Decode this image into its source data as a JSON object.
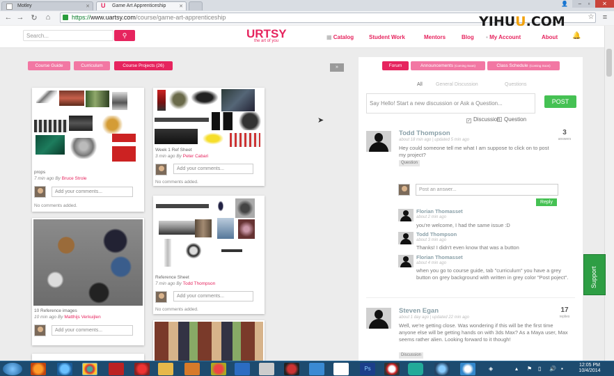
{
  "browser": {
    "tabs": [
      "Motley",
      "Game Art Apprenticeship"
    ],
    "url_scheme": "https://",
    "url_host": "www.uartsy.com",
    "url_path": "/course/game-art-apprenticeship",
    "watermark_a": "YIHU",
    "watermark_b": "U",
    "watermark_c": ".COM"
  },
  "site": {
    "search_placeholder": "Search...",
    "logo": "URTSY",
    "logo_sub": "the art of you",
    "nav": [
      "Catalog",
      "Student Work",
      "Mentors",
      "Blog",
      "My Account",
      "About"
    ]
  },
  "left": {
    "tabs": [
      "Course Guide",
      "Curriculum",
      "Course Projects (26)"
    ],
    "collapse": "»",
    "cards": [
      {
        "title": "props",
        "meta": "7 min ago By",
        "author": "Bruce Strole",
        "input": "Add your comments...",
        "empty": "No comments added."
      },
      {
        "title": "Week 1 Ref Sheet",
        "meta": "3 min ago By",
        "author": "Peter Cabari",
        "input": "Add your comments...",
        "empty": "No comments added."
      },
      {
        "title": "10 Reference images",
        "meta": "10 min ago By",
        "author": "Matthijs Verkuijlen",
        "input": "Add your comments...",
        "empty": ""
      },
      {
        "title": "Reference Sheet",
        "meta": "7 min ago By",
        "author": "Todd Thompson",
        "input": "Add your comments...",
        "empty": "No comments added."
      }
    ]
  },
  "right": {
    "tabs": [
      "Forum",
      "Announcements",
      "Class Schedule"
    ],
    "tab_small": [
      "(Coming Soon)",
      "(Coming Soon)"
    ],
    "filters": [
      "All",
      "General Discussion",
      "Questions"
    ],
    "newpost_placeholder": "Say Hello! Start a new discussion or Ask a Question...",
    "post_button": "POST",
    "check_discussion": "Discussion",
    "check_question": "Question",
    "posts": [
      {
        "name": "Todd Thompson",
        "meta": "about 18 min ago | updated 5 min ago",
        "text": "Hey could someone tell me what I am suppose to click on to post my project?",
        "tag": "Question",
        "count": "3",
        "count_label": "answers"
      },
      {
        "name": "Steven Egan",
        "meta": "about 1 day ago | updated 22 min ago",
        "text": "Well, we're getting close. Was wondering if this will be the first time anyone else will be getting hands on with 3ds Max? As a Maya user, Max seems rather alien. Looking forward to it though!",
        "tag": "Discussion",
        "count": "17",
        "count_label": "replies"
      }
    ],
    "answer_placeholder": "Post an answer...",
    "reply_button": "Reply",
    "replies": [
      {
        "name": "Florian Thomasset",
        "meta": "about 2 min ago",
        "text": "you're welcome, I had the same issue :D"
      },
      {
        "name": "Todd Thompson",
        "meta": "about 3 min ago",
        "text": "Thanks! I didn't even know that was a button"
      },
      {
        "name": "Florian Thomasset",
        "meta": "about 4 min ago",
        "text": "when you go to course guide, tab \"curriculum\" you have a grey button on grey background with written in grey color \"Post poject\"."
      }
    ],
    "support": "Support"
  },
  "taskbar": {
    "time": "12:05 PM",
    "date": "10/4/2014"
  },
  "colors": {
    "brand": "#e6245e",
    "brand_light": "#f277a3",
    "green": "#45c153"
  }
}
